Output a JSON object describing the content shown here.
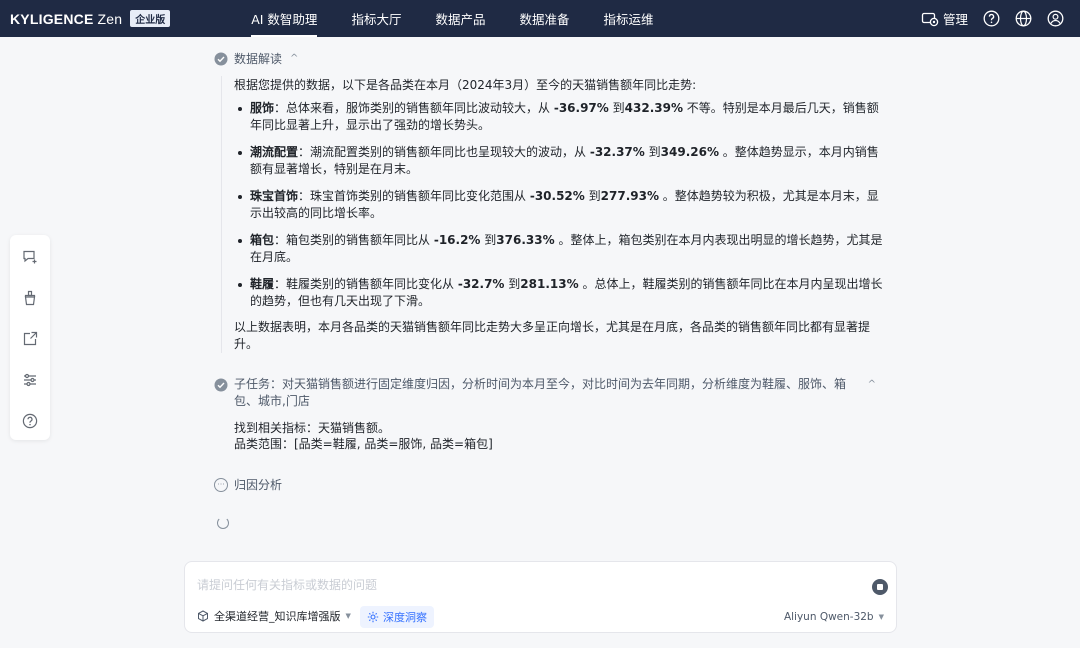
{
  "header": {
    "logo": "KYLIGENCE",
    "logo_suffix": "Zen",
    "edition": "企业版",
    "nav": [
      {
        "label": "AI 数智助理",
        "active": true
      },
      {
        "label": "指标大厅",
        "active": false
      },
      {
        "label": "数据产品",
        "active": false
      },
      {
        "label": "数据准备",
        "active": false
      },
      {
        "label": "指标运维",
        "active": false
      }
    ],
    "manage_label": "管理"
  },
  "sidebar": {
    "icons": [
      "new-chat-icon",
      "clean-icon",
      "export-icon",
      "settings-sliders-icon",
      "help-icon"
    ]
  },
  "analysis": {
    "section_title": "数据解读",
    "intro": "根据您提供的数据，以下是各品类在本月（2024年3月）至今的天猫销售额年同比走势:",
    "items": [
      {
        "name": "服饰",
        "pre": "：总体来看，服饰类别的销售额年同比波动较大，从 ",
        "low": "-36.97%",
        "mid": " 到",
        "high": "432.39%",
        "post": " 不等。特别是本月最后几天，销售额年同比显著上升，显示出了强劲的增长势头。"
      },
      {
        "name": "潮流配置",
        "pre": "：潮流配置类别的销售额年同比也呈现较大的波动，从 ",
        "low": "-32.37%",
        "mid": " 到",
        "high": "349.26%",
        "post": " 。整体趋势显示，本月内销售额有显著增长，特别是在月末。"
      },
      {
        "name": "珠宝首饰",
        "pre": "：珠宝首饰类别的销售额年同比变化范围从 ",
        "low": "-30.52%",
        "mid": " 到",
        "high": "277.93%",
        "post": " 。整体趋势较为积极，尤其是本月末，显示出较高的同比增长率。"
      },
      {
        "name": "箱包",
        "pre": "：箱包类别的销售额年同比从 ",
        "low": "-16.2%",
        "mid": " 到",
        "high": "376.33%",
        "post": " 。整体上，箱包类别在本月内表现出明显的增长趋势，尤其是在月底。"
      },
      {
        "name": "鞋履",
        "pre": "：鞋履类别的销售额年同比变化从 ",
        "low": "-32.7%",
        "mid": " 到",
        "high": "281.13%",
        "post": " 。总体上，鞋履类别的销售额年同比在本月内呈现出增长的趋势，但也有几天出现了下滑。"
      }
    ],
    "summary": "以上数据表明，本月各品类的天猫销售额年同比走势大多呈正向增长，尤其是在月底，各品类的销售额年同比都有显著提升。"
  },
  "subtask": {
    "text": "子任务：对天猫销售额进行固定维度归因，分析时间为本月至今，对比时间为去年同期，分析维度为鞋履、服饰、箱包、城市,门店",
    "metric_line": "找到相关指标：天猫销售额。",
    "scope_line": "品类范围：[品类=鞋履, 品类=服饰, 品类=箱包]"
  },
  "attribution": {
    "title": "归因分析"
  },
  "input": {
    "placeholder": "请提问任何有关指标或数据的问题",
    "value": "",
    "knowledge_base": "全渠道经营_知识库增强版",
    "deep_insight": "深度洞察",
    "model": "Aliyun Qwen-32b"
  }
}
